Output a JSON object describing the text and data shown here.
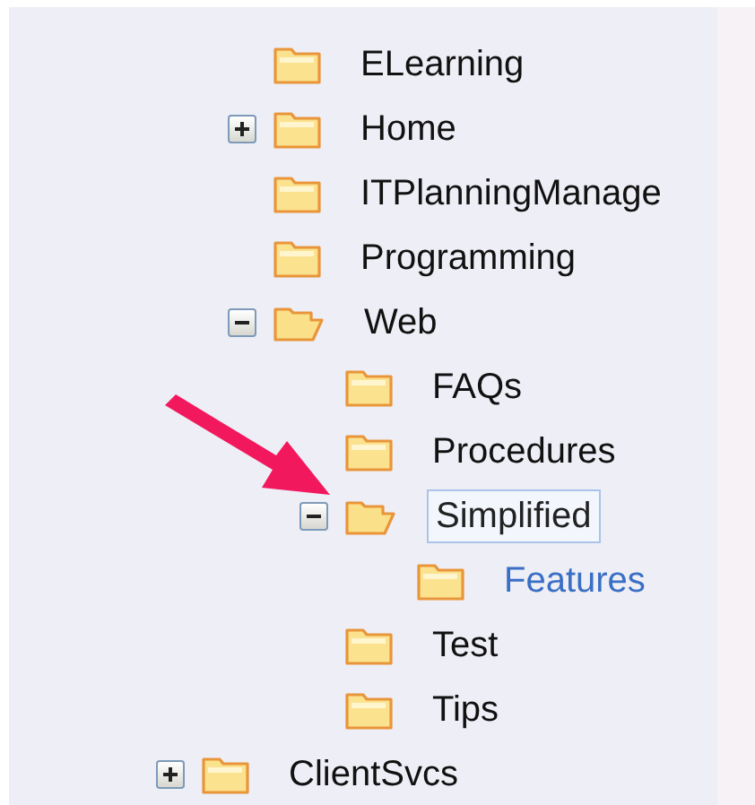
{
  "tree": {
    "items": [
      {
        "children": [
          {
            "label": "ELearning",
            "selected": false,
            "hovered": false
          },
          {
            "label": "Home",
            "selected": false,
            "hovered": false,
            "expanded": false
          },
          {
            "label": "ITPlanningManage",
            "selected": false,
            "hovered": false
          },
          {
            "label": "Programming",
            "selected": false,
            "hovered": false
          },
          {
            "label": "Web",
            "selected": false,
            "hovered": false,
            "expanded": true,
            "children": [
              {
                "label": "FAQs",
                "selected": false,
                "hovered": false
              },
              {
                "label": "Procedures",
                "selected": false,
                "hovered": false
              },
              {
                "label": "Simplified",
                "selected": true,
                "hovered": false,
                "expanded": true,
                "children": [
                  {
                    "label": "Features",
                    "selected": false,
                    "hovered": true
                  }
                ]
              },
              {
                "label": "Test",
                "selected": false,
                "hovered": false
              },
              {
                "label": "Tips",
                "selected": false,
                "hovered": false
              }
            ]
          }
        ]
      },
      {
        "label": "ClientSvcs",
        "selected": false,
        "hovered": false,
        "expanded": false
      }
    ]
  }
}
